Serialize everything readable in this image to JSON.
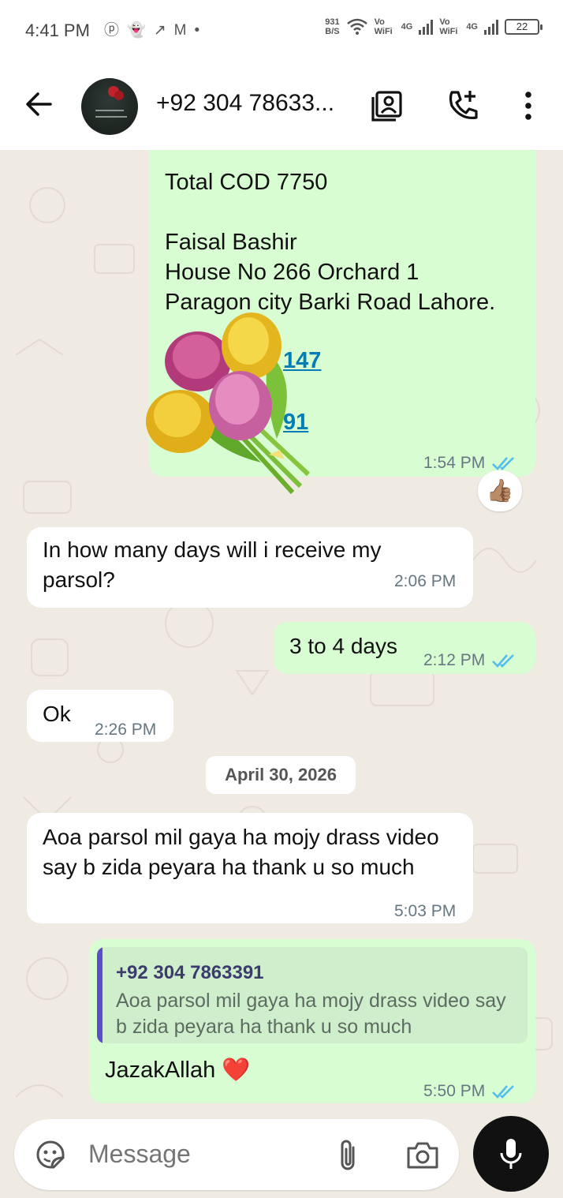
{
  "status_bar": {
    "time": "4:41 PM",
    "notification_icons": [
      "pinterest-icon",
      "snapchat-icon",
      "missed-call-icon",
      "gmail-icon",
      "dot-icon"
    ],
    "speed_value": "931",
    "speed_unit": "B/S",
    "sim1_volte": "Vo WiFi",
    "sim1_net": "4G",
    "sim2_volte": "Vo WiFi",
    "sim2_net": "4G",
    "battery": "22"
  },
  "header": {
    "contact_name": "+92 304 78633...",
    "icons": [
      "back-arrow-icon",
      "contact-card-icon",
      "add-call-icon",
      "more-vert-icon"
    ]
  },
  "messages": {
    "m1": {
      "lines": [
        "Total COD 7750",
        "",
        "Faisal Bashir",
        "House No 266 Orchard 1",
        "Paragon city Barki Road Lahore."
      ],
      "link1": "147",
      "link2": "91",
      "time": "1:54 PM",
      "reaction": "👍🏽"
    },
    "m2": {
      "text": "In how many days will i receive my parsol?",
      "time": "2:06 PM"
    },
    "m3": {
      "text": "3 to 4 days",
      "time": "2:12 PM"
    },
    "m4": {
      "text": "Ok",
      "time": "2:26 PM"
    },
    "date_divider": "April 30, 2026",
    "m5": {
      "text": "Aoa parsol mil gaya ha mojy drass video say b zida peyara ha thank u so much",
      "time": "5:03 PM"
    },
    "m6": {
      "quote_author": "+92 304 7863391",
      "quote_text": "Aoa parsol mil gaya ha mojy drass video say b zida peyara ha thank u so much",
      "text": "JazakAllah ❤️",
      "time": "5:50 PM"
    }
  },
  "composer": {
    "placeholder": "Message",
    "icons": [
      "sticker-icon",
      "attach-icon",
      "camera-icon",
      "mic-icon"
    ]
  },
  "colors": {
    "outgoing_bubble": "#d9fdd3",
    "incoming_bubble": "#ffffff",
    "chat_background": "#efeae2",
    "read_ticks": "#53bdeb",
    "quote_bar": "#5b4fc7"
  }
}
